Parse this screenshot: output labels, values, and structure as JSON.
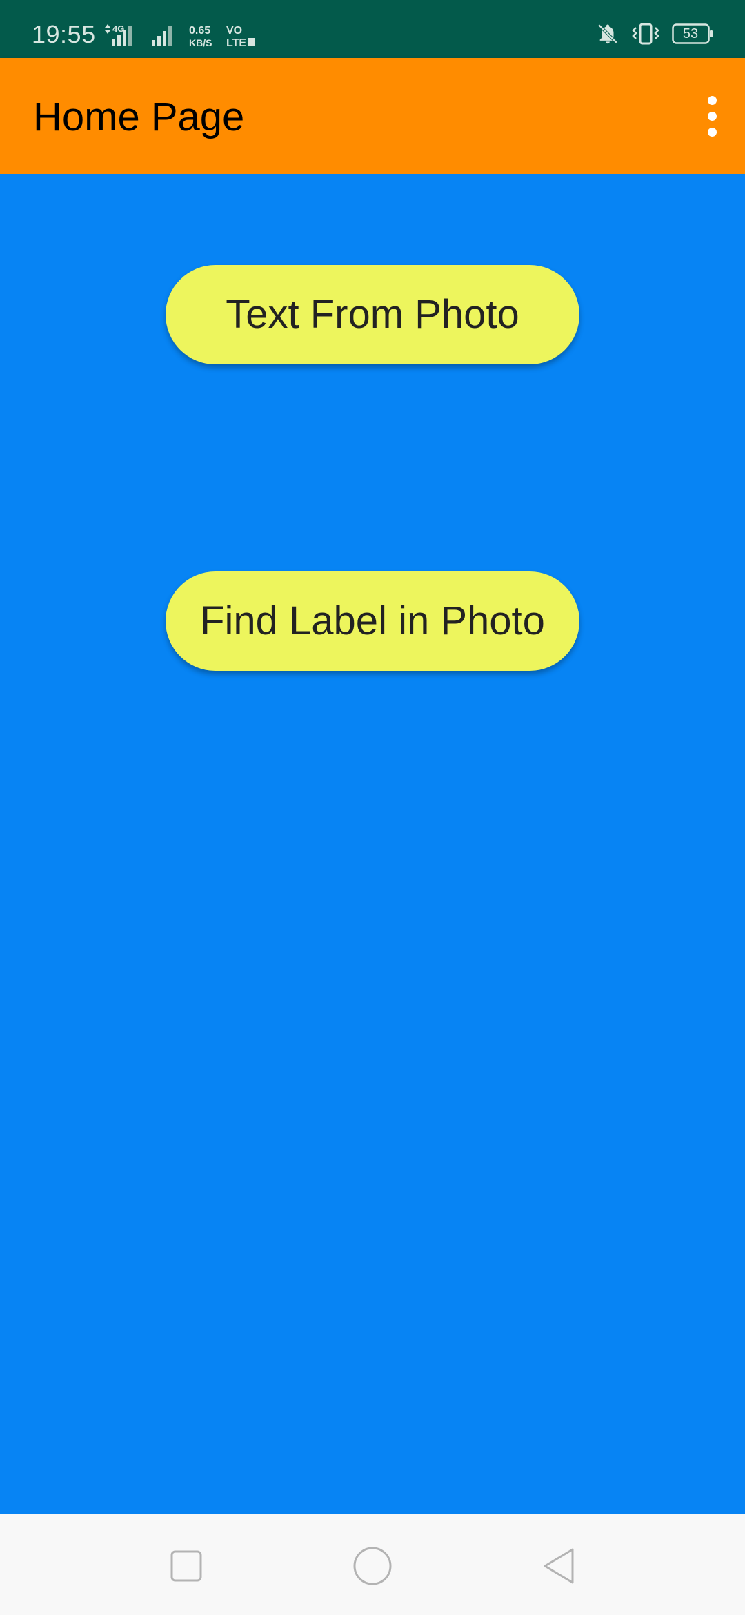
{
  "status_bar": {
    "time": "19:55",
    "network_speed_value": "0.65",
    "network_speed_unit": "KB/S",
    "network_type": "4G",
    "volte_top": "VO",
    "volte_bottom": "LTE",
    "battery_level": "53",
    "icons": [
      "signal-4g-icon",
      "signal-icon",
      "volte-icon",
      "notifications-off-icon",
      "vibrate-icon",
      "battery-icon"
    ]
  },
  "app_bar": {
    "title": "Home Page",
    "overflow_icon": "more-vert-icon",
    "background": "#ff8c00"
  },
  "main": {
    "background": "#0784f4",
    "buttons": [
      {
        "label": "Text From Photo"
      },
      {
        "label": "Find Label in Photo"
      }
    ],
    "button_color": "#edf55d"
  },
  "nav_bar": {
    "items": [
      "recents-square-icon",
      "home-circle-icon",
      "back-triangle-icon"
    ]
  }
}
